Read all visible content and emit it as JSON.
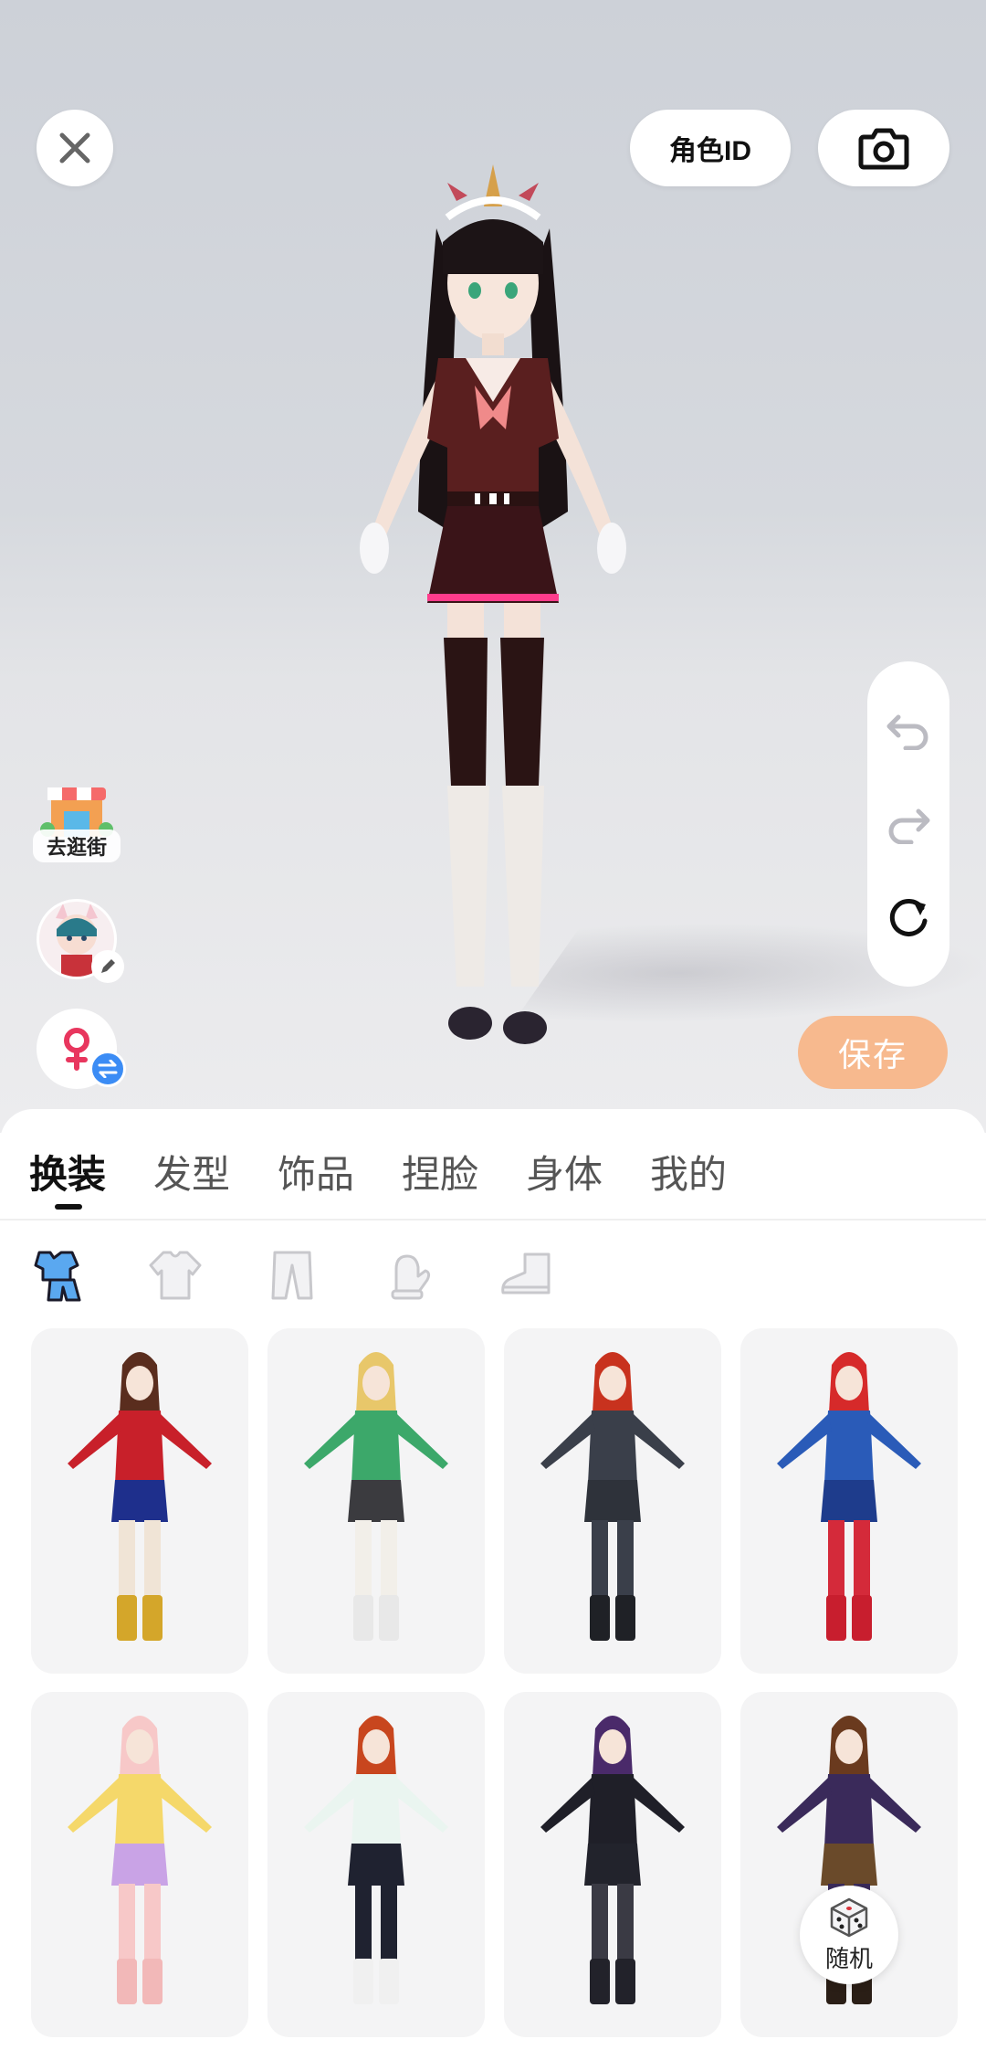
{
  "top_bar": {
    "close_icon": "close-icon",
    "role_id_label": "角色ID",
    "camera_icon": "camera-icon"
  },
  "history": {
    "undo_icon": "undo-icon",
    "redo_icon": "redo-icon",
    "reset_icon": "reset-icon"
  },
  "save_label": "保存",
  "side_buttons": {
    "shop_label": "去逛街",
    "gender_icon": "female-icon",
    "swap_icon": "swap-icon"
  },
  "tabs": [
    {
      "label": "换装",
      "active": true
    },
    {
      "label": "发型",
      "active": false
    },
    {
      "label": "饰品",
      "active": false
    },
    {
      "label": "捏脸",
      "active": false
    },
    {
      "label": "身体",
      "active": false
    },
    {
      "label": "我的",
      "active": false
    }
  ],
  "subcategories": [
    {
      "icon": "full-outfit-icon",
      "active": true
    },
    {
      "icon": "top-shirt-icon",
      "active": false
    },
    {
      "icon": "pants-icon",
      "active": false
    },
    {
      "icon": "glove-icon",
      "active": false
    },
    {
      "icon": "shoe-icon",
      "active": false
    }
  ],
  "outfits": [
    {
      "name": "outfit-wonder-hero",
      "colors": {
        "hair": "#5a2d1e",
        "top": "#c8202a",
        "bottom": "#1e2f8c",
        "legs": "#f0e4d6",
        "boots": "#d4a62a"
      }
    },
    {
      "name": "outfit-green-ninja",
      "colors": {
        "hair": "#e8c76a",
        "top": "#3ca86a",
        "bottom": "#3b3b3f",
        "legs": "#f2efe9",
        "boots": "#e8e8e8"
      }
    },
    {
      "name": "outfit-black-suit",
      "colors": {
        "hair": "#c8321e",
        "top": "#3a3f4a",
        "bottom": "#2e323a",
        "legs": "#3a3f4a",
        "boots": "#1f2126"
      }
    },
    {
      "name": "outfit-captain-hero",
      "colors": {
        "hair": "#d62a2a",
        "top": "#2a5bb8",
        "bottom": "#1e3c8c",
        "legs": "#d42a3a",
        "boots": "#c81e2e"
      }
    },
    {
      "name": "outfit-pink-cat",
      "colors": {
        "hair": "#f7c8c8",
        "top": "#f5d86a",
        "bottom": "#c9a3e6",
        "legs": "#f7c8c8",
        "boots": "#f2b8b8"
      }
    },
    {
      "name": "outfit-sport-track",
      "colors": {
        "hair": "#c8461e",
        "top": "#eaf5f0",
        "bottom": "#1f2230",
        "legs": "#1f2230",
        "boots": "#f0f0f0"
      }
    },
    {
      "name": "outfit-gothic-dress",
      "colors": {
        "hair": "#4a2a6a",
        "top": "#1f1f28",
        "bottom": "#22232c",
        "legs": "#3a3a44",
        "boots": "#22222a"
      }
    },
    {
      "name": "outfit-school-robe",
      "colors": {
        "hair": "#6a3a1e",
        "top": "#3a2a5a",
        "bottom": "#6a4a2a",
        "legs": "#3a2a5a",
        "boots": "#2a1e16"
      }
    }
  ],
  "random_label": "随机",
  "random_icon": "dice-icon"
}
